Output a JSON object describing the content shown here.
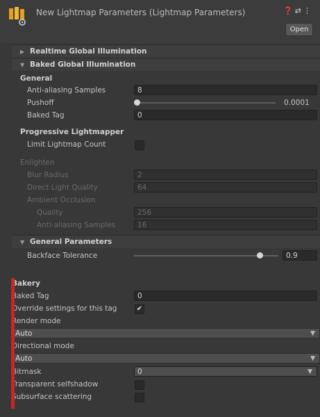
{
  "header": {
    "title": "New Lightmap Parameters (Lightmap Parameters)",
    "open_label": "Open",
    "icons": [
      "help-icon",
      "settings-sliders-icon",
      "more-menu-icon"
    ]
  },
  "sections": {
    "realtime": "Realtime Global Illumination",
    "baked": "Baked Global Illumination",
    "general_params": "General Parameters"
  },
  "baked": {
    "general_heading": "General",
    "aa_label": "Anti-aliasing Samples",
    "aa_value": "8",
    "pushoff_label": "Pushoff",
    "pushoff_value": "0.0001",
    "pushoff_level": 0,
    "baked_tag_label": "Baked Tag",
    "baked_tag_value": "0",
    "prog_heading": "Progressive Lightmapper",
    "limit_label": "Limit Lightmap Count",
    "limit_checked": false
  },
  "enlighten": {
    "heading": "Enlighten",
    "blur_label": "Blur Radius",
    "blur_value": "2",
    "dlq_label": "Direct Light Quality",
    "dlq_value": "64",
    "ao_label": "Ambient Occlusion",
    "quality_label": "Quality",
    "quality_value": "256",
    "aa_label": "Anti-aliasing Samples",
    "aa_value": "16"
  },
  "general_params": {
    "backface_label": "Backface Tolerance",
    "backface_value": "0.9",
    "backface_level": 0.9
  },
  "bakery": {
    "heading": "Bakery",
    "baked_tag_label": "Baked Tag",
    "baked_tag_value": "0",
    "override_label": "Override settings for this tag",
    "override_checked": true,
    "override_mark": "✔",
    "render_mode_label": "Render mode",
    "render_mode_value": "Auto",
    "directional_label": "Directional mode",
    "directional_value": "Auto",
    "bitmask_label": "Bitmask",
    "bitmask_value": "0",
    "transparent_label": "Transparent selfshadow",
    "transparent_checked": false,
    "subsurface_label": "Subsurface scattering",
    "subsurface_checked": false
  },
  "colors": {
    "accent_bar": "#c62828",
    "background": "#383838"
  }
}
